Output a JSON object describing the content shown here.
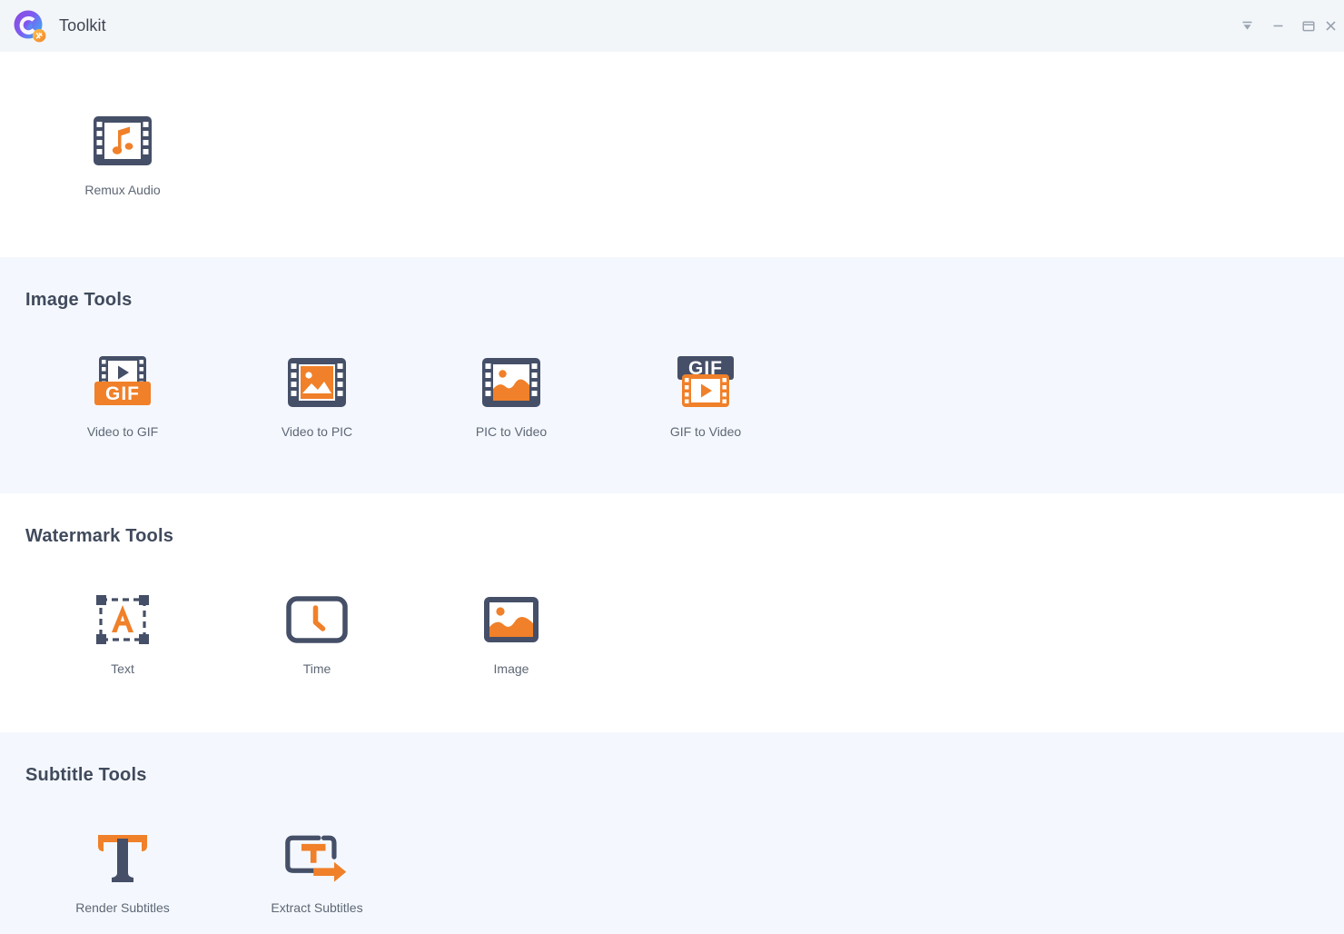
{
  "window": {
    "title": "Toolkit",
    "logo_icon": "toolkit-logo-icon",
    "controls": [
      {
        "name": "collapse-button",
        "icon": "arrow-down-bar-icon",
        "label": ""
      },
      {
        "name": "minimize-button",
        "icon": "minimize-icon",
        "label": ""
      },
      {
        "name": "maximize-button",
        "icon": "maximize-icon",
        "label": ""
      },
      {
        "name": "close-button",
        "icon": "close-icon",
        "label": ""
      }
    ]
  },
  "sections": [
    {
      "id": "top",
      "title": "",
      "background": "#ffffff",
      "tools": [
        {
          "label": "Remux Audio",
          "icon": "film-music-note-icon"
        }
      ]
    },
    {
      "id": "image-tools",
      "title": "Image Tools",
      "background": "#f4f8fe",
      "tools": [
        {
          "label": "Video to GIF",
          "icon": "film-play-gif-icon"
        },
        {
          "label": "Video to PIC",
          "icon": "film-picture-icon"
        },
        {
          "label": "PIC to Video",
          "icon": "film-landscape-icon"
        },
        {
          "label": "GIF to Video",
          "icon": "gif-film-play-icon"
        }
      ]
    },
    {
      "id": "watermark-tools",
      "title": "Watermark Tools",
      "background": "#ffffff",
      "tools": [
        {
          "label": "Text",
          "icon": "text-selection-a-icon"
        },
        {
          "label": "Time",
          "icon": "clock-frame-icon"
        },
        {
          "label": "Image",
          "icon": "image-frame-icon"
        }
      ]
    },
    {
      "id": "subtitle-tools",
      "title": "Subtitle Tools",
      "background": "#f4f8fe",
      "tools": [
        {
          "label": "Render Subtitles",
          "icon": "serif-t-icon"
        },
        {
          "label": "Extract Subtitles",
          "icon": "t-box-arrow-icon"
        }
      ]
    }
  ],
  "colors": {
    "accent_orange": "#f08029",
    "dark_navy": "#454f67",
    "titlebar_bg": "#f3f6f9",
    "tinted_section_bg": "#f4f8fe",
    "label_text": "#5e6775",
    "heading_text": "#404a5c"
  }
}
